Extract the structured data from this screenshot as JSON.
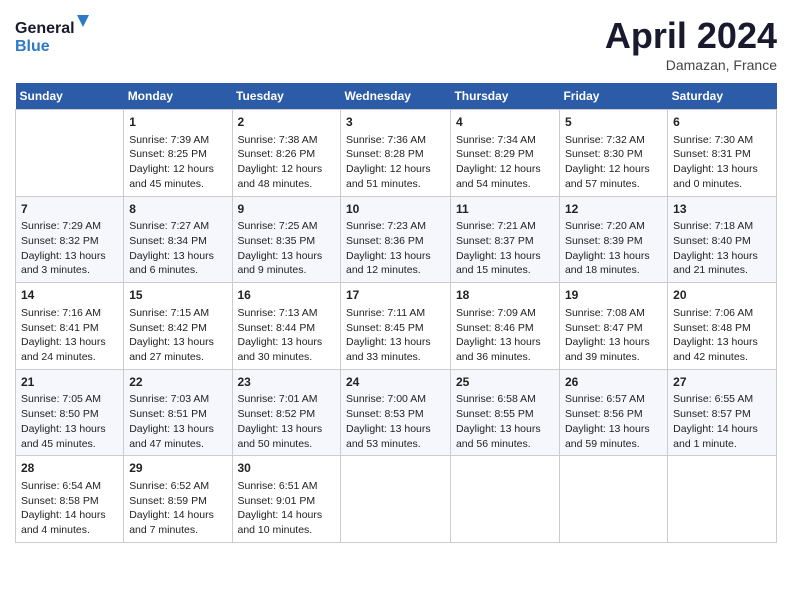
{
  "header": {
    "logo_line1": "General",
    "logo_line2": "Blue",
    "month": "April 2024",
    "location": "Damazan, France"
  },
  "days_of_week": [
    "Sunday",
    "Monday",
    "Tuesday",
    "Wednesday",
    "Thursday",
    "Friday",
    "Saturday"
  ],
  "weeks": [
    [
      {
        "day": "",
        "info": ""
      },
      {
        "day": "1",
        "info": "Sunrise: 7:39 AM\nSunset: 8:25 PM\nDaylight: 12 hours\nand 45 minutes."
      },
      {
        "day": "2",
        "info": "Sunrise: 7:38 AM\nSunset: 8:26 PM\nDaylight: 12 hours\nand 48 minutes."
      },
      {
        "day": "3",
        "info": "Sunrise: 7:36 AM\nSunset: 8:28 PM\nDaylight: 12 hours\nand 51 minutes."
      },
      {
        "day": "4",
        "info": "Sunrise: 7:34 AM\nSunset: 8:29 PM\nDaylight: 12 hours\nand 54 minutes."
      },
      {
        "day": "5",
        "info": "Sunrise: 7:32 AM\nSunset: 8:30 PM\nDaylight: 12 hours\nand 57 minutes."
      },
      {
        "day": "6",
        "info": "Sunrise: 7:30 AM\nSunset: 8:31 PM\nDaylight: 13 hours\nand 0 minutes."
      }
    ],
    [
      {
        "day": "7",
        "info": "Sunrise: 7:29 AM\nSunset: 8:32 PM\nDaylight: 13 hours\nand 3 minutes."
      },
      {
        "day": "8",
        "info": "Sunrise: 7:27 AM\nSunset: 8:34 PM\nDaylight: 13 hours\nand 6 minutes."
      },
      {
        "day": "9",
        "info": "Sunrise: 7:25 AM\nSunset: 8:35 PM\nDaylight: 13 hours\nand 9 minutes."
      },
      {
        "day": "10",
        "info": "Sunrise: 7:23 AM\nSunset: 8:36 PM\nDaylight: 13 hours\nand 12 minutes."
      },
      {
        "day": "11",
        "info": "Sunrise: 7:21 AM\nSunset: 8:37 PM\nDaylight: 13 hours\nand 15 minutes."
      },
      {
        "day": "12",
        "info": "Sunrise: 7:20 AM\nSunset: 8:39 PM\nDaylight: 13 hours\nand 18 minutes."
      },
      {
        "day": "13",
        "info": "Sunrise: 7:18 AM\nSunset: 8:40 PM\nDaylight: 13 hours\nand 21 minutes."
      }
    ],
    [
      {
        "day": "14",
        "info": "Sunrise: 7:16 AM\nSunset: 8:41 PM\nDaylight: 13 hours\nand 24 minutes."
      },
      {
        "day": "15",
        "info": "Sunrise: 7:15 AM\nSunset: 8:42 PM\nDaylight: 13 hours\nand 27 minutes."
      },
      {
        "day": "16",
        "info": "Sunrise: 7:13 AM\nSunset: 8:44 PM\nDaylight: 13 hours\nand 30 minutes."
      },
      {
        "day": "17",
        "info": "Sunrise: 7:11 AM\nSunset: 8:45 PM\nDaylight: 13 hours\nand 33 minutes."
      },
      {
        "day": "18",
        "info": "Sunrise: 7:09 AM\nSunset: 8:46 PM\nDaylight: 13 hours\nand 36 minutes."
      },
      {
        "day": "19",
        "info": "Sunrise: 7:08 AM\nSunset: 8:47 PM\nDaylight: 13 hours\nand 39 minutes."
      },
      {
        "day": "20",
        "info": "Sunrise: 7:06 AM\nSunset: 8:48 PM\nDaylight: 13 hours\nand 42 minutes."
      }
    ],
    [
      {
        "day": "21",
        "info": "Sunrise: 7:05 AM\nSunset: 8:50 PM\nDaylight: 13 hours\nand 45 minutes."
      },
      {
        "day": "22",
        "info": "Sunrise: 7:03 AM\nSunset: 8:51 PM\nDaylight: 13 hours\nand 47 minutes."
      },
      {
        "day": "23",
        "info": "Sunrise: 7:01 AM\nSunset: 8:52 PM\nDaylight: 13 hours\nand 50 minutes."
      },
      {
        "day": "24",
        "info": "Sunrise: 7:00 AM\nSunset: 8:53 PM\nDaylight: 13 hours\nand 53 minutes."
      },
      {
        "day": "25",
        "info": "Sunrise: 6:58 AM\nSunset: 8:55 PM\nDaylight: 13 hours\nand 56 minutes."
      },
      {
        "day": "26",
        "info": "Sunrise: 6:57 AM\nSunset: 8:56 PM\nDaylight: 13 hours\nand 59 minutes."
      },
      {
        "day": "27",
        "info": "Sunrise: 6:55 AM\nSunset: 8:57 PM\nDaylight: 14 hours\nand 1 minute."
      }
    ],
    [
      {
        "day": "28",
        "info": "Sunrise: 6:54 AM\nSunset: 8:58 PM\nDaylight: 14 hours\nand 4 minutes."
      },
      {
        "day": "29",
        "info": "Sunrise: 6:52 AM\nSunset: 8:59 PM\nDaylight: 14 hours\nand 7 minutes."
      },
      {
        "day": "30",
        "info": "Sunrise: 6:51 AM\nSunset: 9:01 PM\nDaylight: 14 hours\nand 10 minutes."
      },
      {
        "day": "",
        "info": ""
      },
      {
        "day": "",
        "info": ""
      },
      {
        "day": "",
        "info": ""
      },
      {
        "day": "",
        "info": ""
      }
    ]
  ]
}
